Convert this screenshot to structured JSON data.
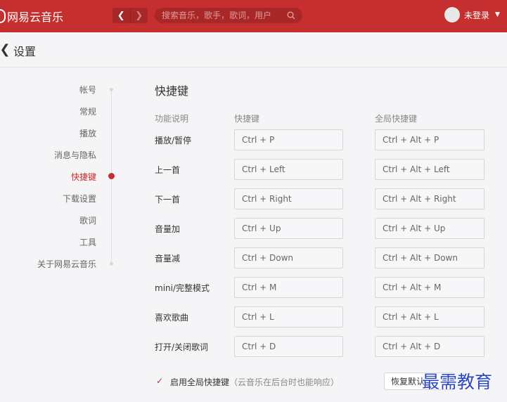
{
  "app": {
    "name": "网易云音乐"
  },
  "titlebar": {
    "back_icon": "chevron-left-icon",
    "forward_icon": "chevron-right-icon",
    "search": {
      "placeholder": "搜索音乐，歌手，歌词，用户",
      "value": ""
    },
    "user": {
      "label": "未登录",
      "menu_icon": "triangle-down-icon"
    },
    "colors": {
      "bar": "#c62f2f",
      "accent": "#c62f2f"
    }
  },
  "page": {
    "title": "设置",
    "back_icon": "chevron-left-icon"
  },
  "sidebar": {
    "items": [
      {
        "label": "帐号",
        "active": false
      },
      {
        "label": "常规",
        "active": false
      },
      {
        "label": "播放",
        "active": false
      },
      {
        "label": "消息与隐私",
        "active": false
      },
      {
        "label": "快捷键",
        "active": true
      },
      {
        "label": "下载设置",
        "active": false
      },
      {
        "label": "歌词",
        "active": false
      },
      {
        "label": "工具",
        "active": false
      },
      {
        "label": "关于网易云音乐",
        "active": false
      }
    ]
  },
  "shortcuts": {
    "title": "快捷键",
    "headers": {
      "function": "功能说明",
      "local": "快捷键",
      "global": "全局快捷键"
    },
    "rows": [
      {
        "function": "播放/暂停",
        "local": "Ctrl + P",
        "global": "Ctrl + Alt + P"
      },
      {
        "function": "上一首",
        "local": "Ctrl + Left",
        "global": "Ctrl + Alt + Left"
      },
      {
        "function": "下一首",
        "local": "Ctrl + Right",
        "global": "Ctrl + Alt + Right"
      },
      {
        "function": "音量加",
        "local": "Ctrl + Up",
        "global": "Ctrl + Alt + Up"
      },
      {
        "function": "音量减",
        "local": "Ctrl + Down",
        "global": "Ctrl + Alt + Down"
      },
      {
        "function": "mini/完整模式",
        "local": "Ctrl + M",
        "global": "Ctrl + Alt + M"
      },
      {
        "function": "喜欢歌曲",
        "local": "Ctrl + L",
        "global": "Ctrl + Alt + L"
      },
      {
        "function": "打开/关闭歌词",
        "local": "Ctrl + D",
        "global": "Ctrl + Alt + D"
      }
    ],
    "global_toggle": {
      "checked": true,
      "label": "启用全局快捷键",
      "hint": "（云音乐在后台时也能响应）"
    },
    "restore_label": "恢复默认"
  },
  "watermark": {
    "text": "最需教育"
  }
}
